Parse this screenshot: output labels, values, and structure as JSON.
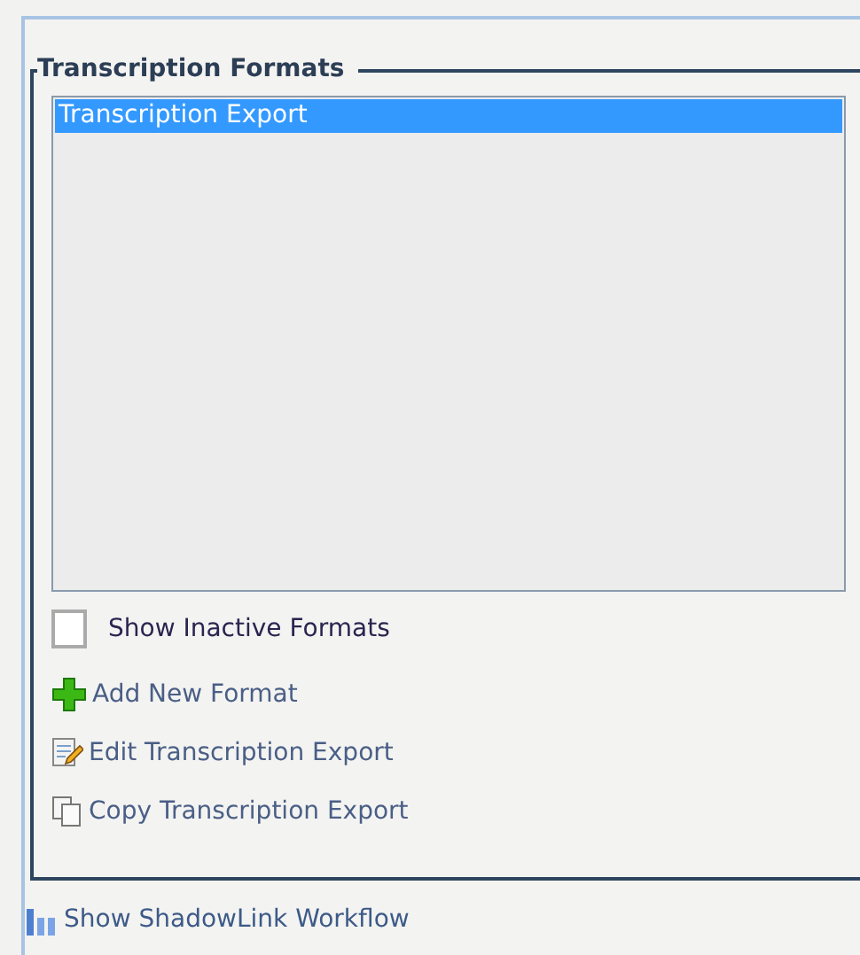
{
  "panel": {
    "title": "Transcription Formats",
    "list": [
      {
        "label": "Transcription Export",
        "selected": true
      }
    ],
    "show_inactive": {
      "label": "Show Inactive Formats",
      "checked": false
    },
    "actions": [
      {
        "kind": "add",
        "label": "Add New Format"
      },
      {
        "kind": "edit",
        "label": "Edit Transcription Export"
      },
      {
        "kind": "copy",
        "label": "Copy Transcription Export"
      }
    ]
  },
  "footer_link": {
    "label": "Show ShadowLink Workflow"
  }
}
